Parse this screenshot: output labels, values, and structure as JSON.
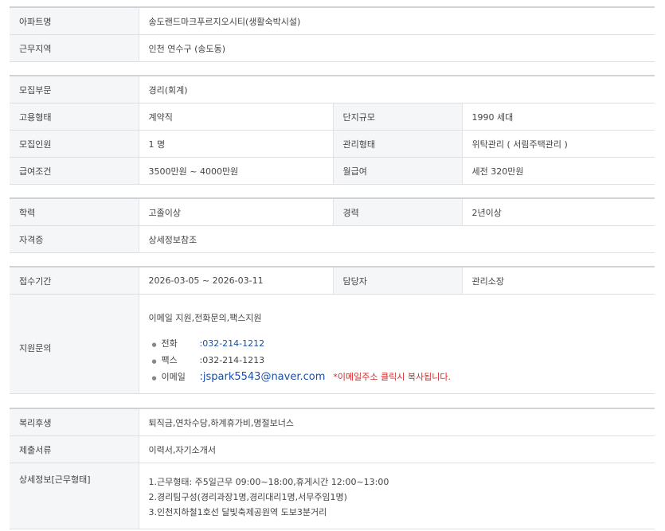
{
  "section1": {
    "apt_label": "아파트명",
    "apt_value": "송도랜드마크푸르지오시티(생활숙박시설)",
    "region_label": "근무지역",
    "region_value": "인천  연수구 (송도동)"
  },
  "section2": {
    "dept_label": "모집부문",
    "dept_value": "경리(회계)",
    "emp_type_label": "고용형태",
    "emp_type_value": "계약직",
    "complex_label": "단지규모",
    "complex_value": "1990 세대",
    "headcount_label": "모집인원",
    "headcount_value": "1 명",
    "mgmt_label": "관리형태",
    "mgmt_value": "위탁관리 ( 서림주택관리 )",
    "salary_label": "급여조건",
    "salary_value": "3500만원 ~ 4000만원",
    "monthly_label": "월급여",
    "monthly_value": "세전 320만원"
  },
  "section3": {
    "edu_label": "학력",
    "edu_value": "고졸이상",
    "career_label": "경력",
    "career_value": "2년이상",
    "cert_label": "자격증",
    "cert_value": "상세정보참조"
  },
  "section4": {
    "period_label": "접수기간",
    "period_value": "2026-03-05 ~ 2026-03-11",
    "manager_label": "담당자",
    "manager_value": "관리소장",
    "inquiry_label": "지원문의",
    "inquiry_methods": "이메일 지원,전화문의,팩스지원",
    "phone_label": "전화",
    "phone_value": ":032-214-1212",
    "fax_label": "팩스",
    "fax_value": ":032-214-1213",
    "email_label": "이메일",
    "email_value": ":jspark5543@naver.com",
    "copy_note": "*이메일주소 클릭시 복사됩니다.",
    "bullet": "●"
  },
  "section5": {
    "welfare_label": "복리후생",
    "welfare_value": "퇴직금,연차수당,하계휴가비,명절보너스",
    "docs_label": "제출서류",
    "docs_value": "이력서,자기소개서",
    "detail_label": "상세정보[근무형태]",
    "detail_lines": [
      "1.근무형태: 주5일근무 09:00~18:00,휴게시간 12:00~13:00",
      "2.경리팀구성(경리과장1명,경리대리1명,서무주임1명)",
      "3.인천지하철1호선 달빛축제공원역 도보3분거리"
    ]
  },
  "colors": {
    "accent_link": "#1b4fa3",
    "notice_red": "#d62b2b",
    "header_bg": "#f5f6f7"
  }
}
